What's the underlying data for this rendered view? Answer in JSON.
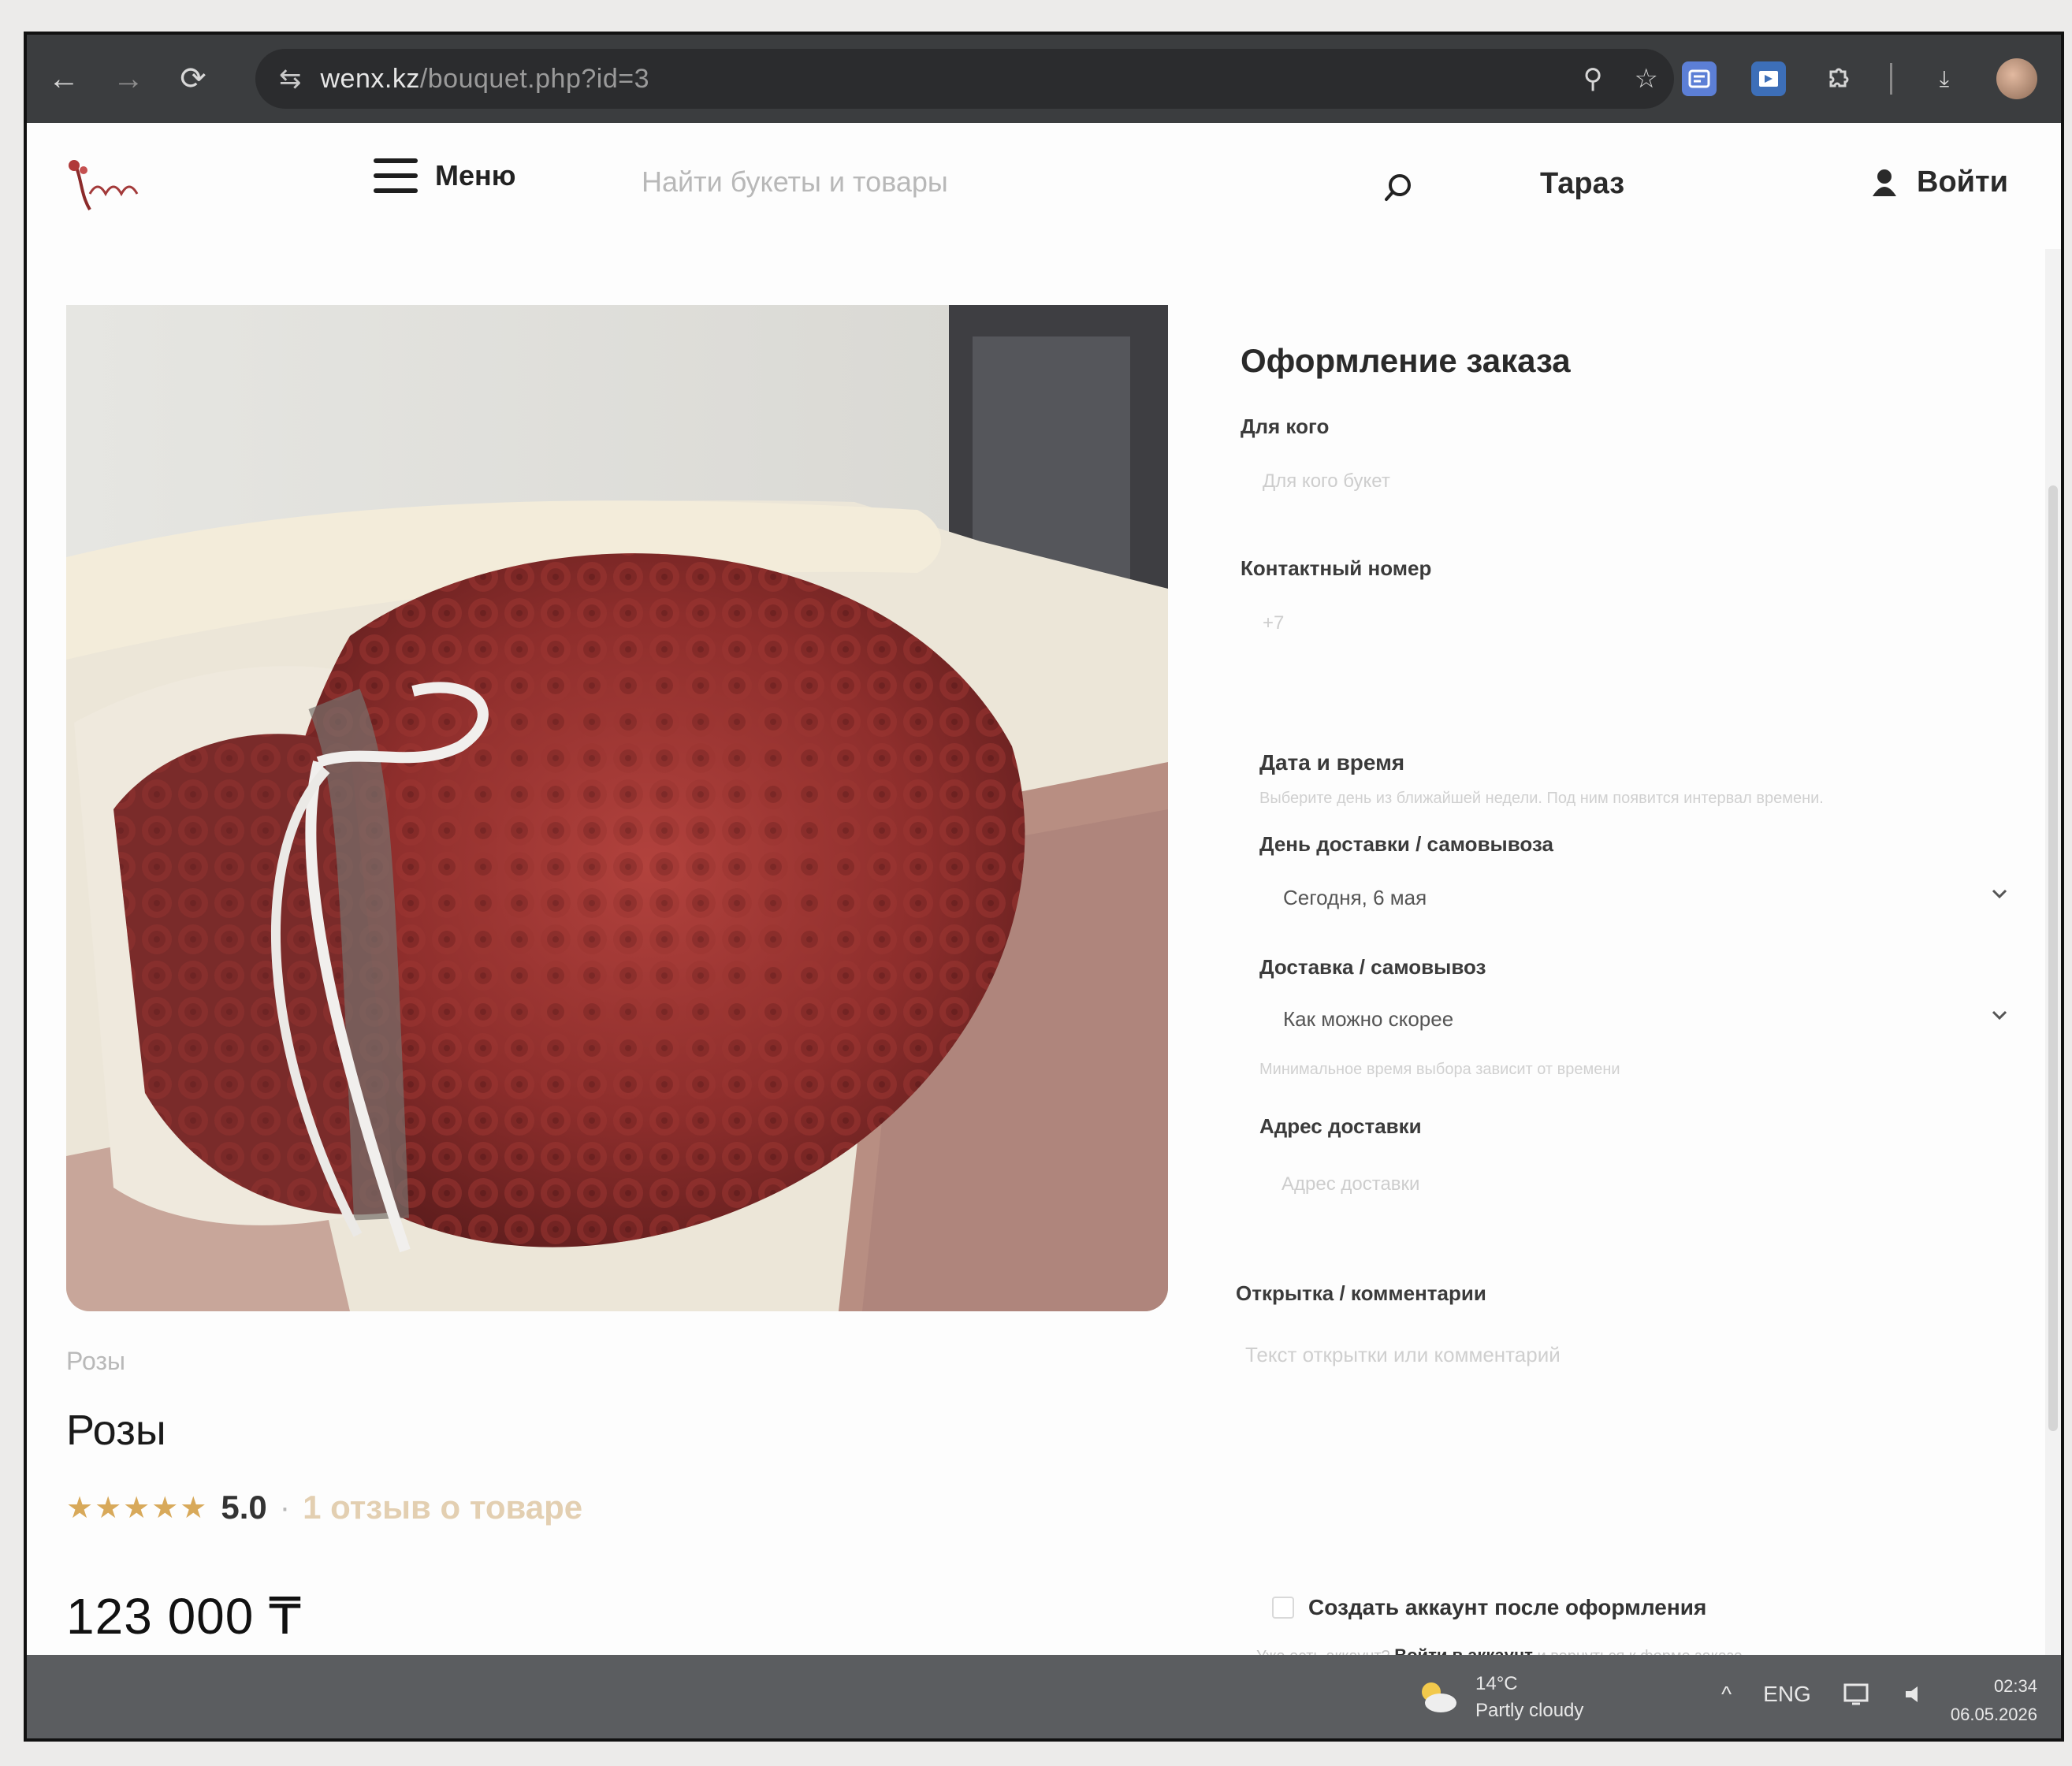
{
  "browser": {
    "url_host": "wenx.kz",
    "url_path": "/bouquet.php?id=3",
    "back_icon": "←",
    "forward_icon": "→",
    "reload_icon": "⟳",
    "tune_icon": "⇆",
    "zoom_icon": "⚲",
    "star_icon": "☆",
    "download_icon": "⤓"
  },
  "header": {
    "menu_label": "Меню",
    "search_placeholder": "Найти букеты и товары",
    "city": "Тараз",
    "login_label": "Войти"
  },
  "product": {
    "category": "Розы",
    "title": "Розы",
    "stars": "★★★★★",
    "rating_value": "5.0",
    "rating_dash": "·",
    "review_link": "1 отзыв о товаре",
    "price": "123 000 ₸"
  },
  "order_form": {
    "title": "Оформление заказа",
    "recipient_label": "Для кого",
    "recipient_placeholder": "Для кого букет",
    "phone_label": "Контактный номер",
    "phone_placeholder": "+7",
    "datetime_title": "Дата и время",
    "datetime_hint": "Выберите день из ближайшей недели. Под ним появится интервал времени.",
    "day_label": "День доставки / самовывоза",
    "day_value": "Сегодня, 6 мая",
    "mode_label": "Доставка / самовывоз",
    "mode_value": "Как можно скорее",
    "mode_hint": "Минимальное время выбора зависит от времени",
    "address_label": "Адрес доставки",
    "address_placeholder": "Адрес доставки",
    "comment_label": "Открытка / комментарии",
    "comment_placeholder": "Текст открытки или комментарий",
    "create_account_label": "Создать аккаунт после оформления",
    "login_hint_pre": "Уже есть аккаунт?",
    "login_hint_link": "Войти в аккаунт",
    "login_hint_post": "и вернуться к форме заказа"
  },
  "taskbar": {
    "temperature": "14°C",
    "weather": "Partly cloudy",
    "language": "ENG",
    "chevron": "^",
    "time": "02:34",
    "date": "06.05.2026"
  },
  "colors": {
    "accent_gold": "#d8a95a",
    "review_link": "#e3cfb1",
    "browser_bar": "#3b3d3f",
    "taskbar": "#5b5d60"
  }
}
